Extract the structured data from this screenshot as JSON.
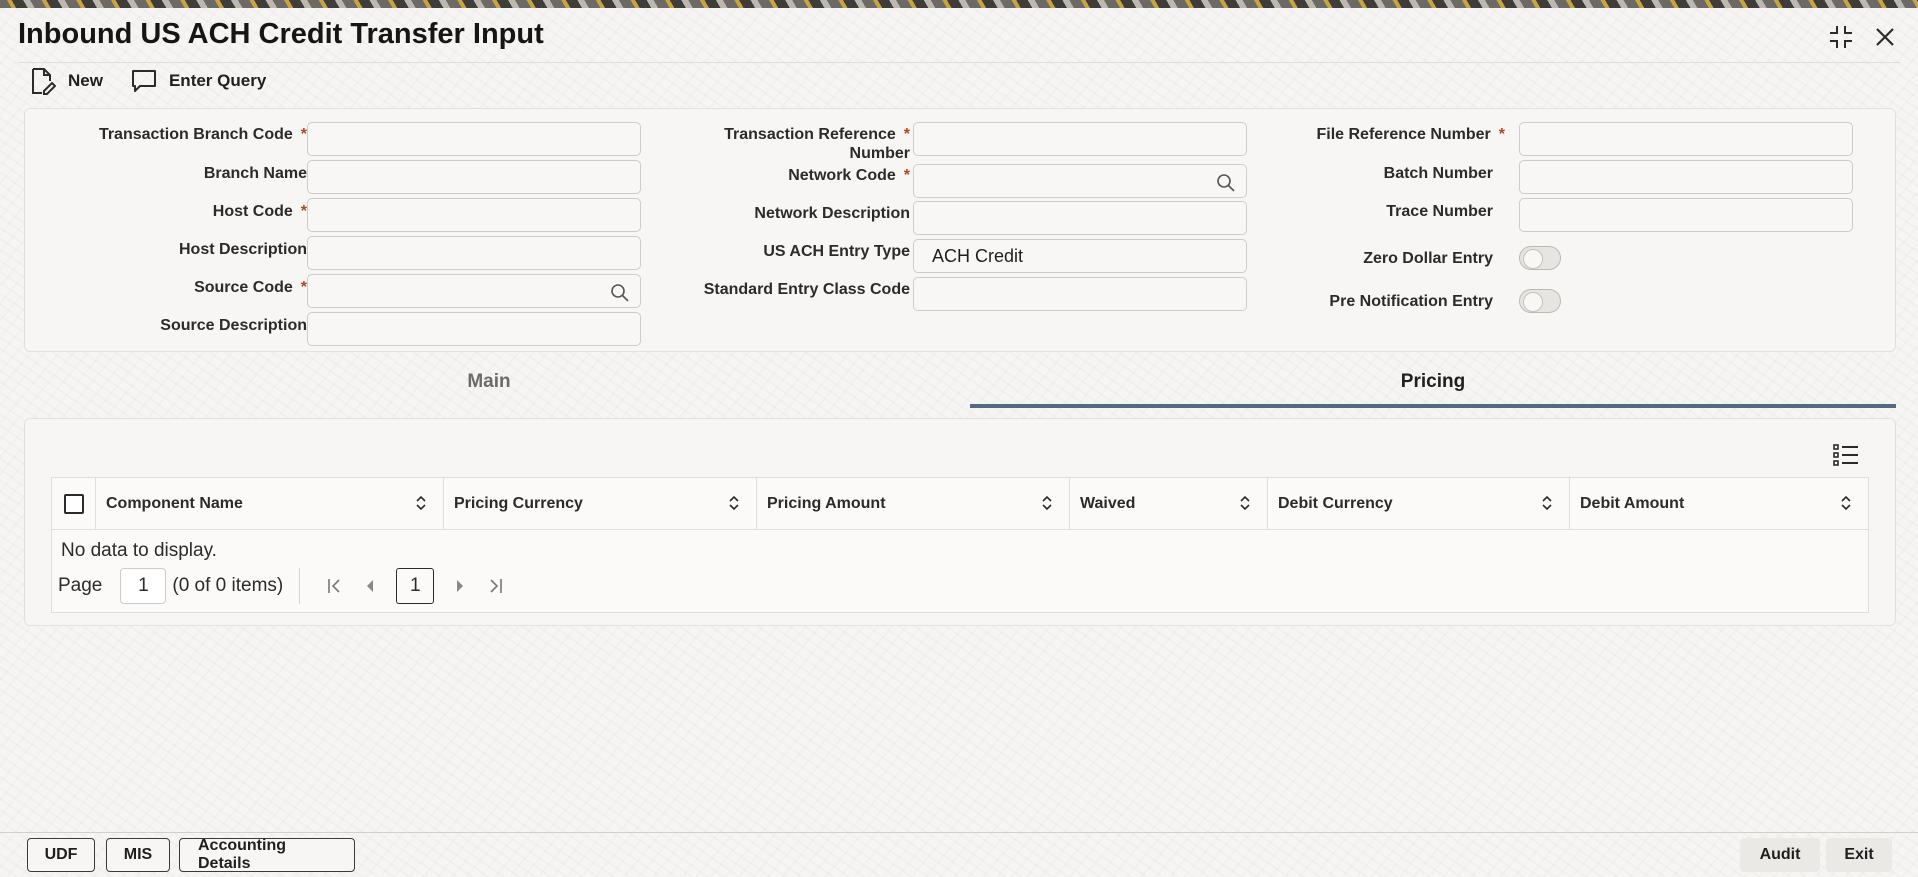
{
  "window": {
    "title": "Inbound US ACH Credit Transfer Input"
  },
  "toolbar": {
    "new_label": "New",
    "enter_query_label": "Enter Query"
  },
  "form": {
    "transaction_branch_code": {
      "label": "Transaction Branch Code",
      "required": "*",
      "value": ""
    },
    "branch_name": {
      "label": "Branch Name",
      "value": ""
    },
    "host_code": {
      "label": "Host Code",
      "required": "*",
      "value": ""
    },
    "host_description": {
      "label": "Host Description",
      "value": ""
    },
    "source_code": {
      "label": "Source Code",
      "required": "*",
      "value": ""
    },
    "source_description": {
      "label": "Source Description",
      "value": ""
    },
    "transaction_reference_number": {
      "label_line1": "Transaction Reference",
      "label_line2": "Number",
      "required": "*",
      "value": ""
    },
    "network_code": {
      "label": "Network Code",
      "required": "*",
      "value": ""
    },
    "network_description": {
      "label": "Network Description",
      "value": ""
    },
    "us_ach_entry_type": {
      "label": "US ACH Entry Type",
      "value": "ACH Credit"
    },
    "standard_entry_class_code": {
      "label": "Standard Entry Class Code",
      "value": ""
    },
    "file_reference_number": {
      "label": "File Reference Number",
      "required": "*",
      "value": ""
    },
    "batch_number": {
      "label": "Batch Number",
      "value": ""
    },
    "trace_number": {
      "label": "Trace Number",
      "value": ""
    },
    "zero_dollar_entry": {
      "label": "Zero Dollar Entry",
      "checked": false
    },
    "pre_notification_entry": {
      "label": "Pre Notification Entry",
      "checked": false
    }
  },
  "tabs": [
    {
      "label": "Main",
      "active": false
    },
    {
      "label": "Pricing",
      "active": true
    }
  ],
  "pricing_grid": {
    "columns": [
      "Component Name",
      "Pricing Currency",
      "Pricing Amount",
      "Waived",
      "Debit Currency",
      "Debit Amount"
    ],
    "rows": [],
    "empty_text": "No data to display.",
    "pager": {
      "page_label": "Page",
      "page_value": "1",
      "items_text": "(0 of 0 items)",
      "current_page": "1"
    }
  },
  "footer": {
    "udf_label": "UDF",
    "mis_label": "MIS",
    "accounting_details_label": "Accounting Details",
    "audit_label": "Audit",
    "exit_label": "Exit"
  },
  "colors": {
    "accent": "#546a82",
    "required": "#b0461f"
  }
}
